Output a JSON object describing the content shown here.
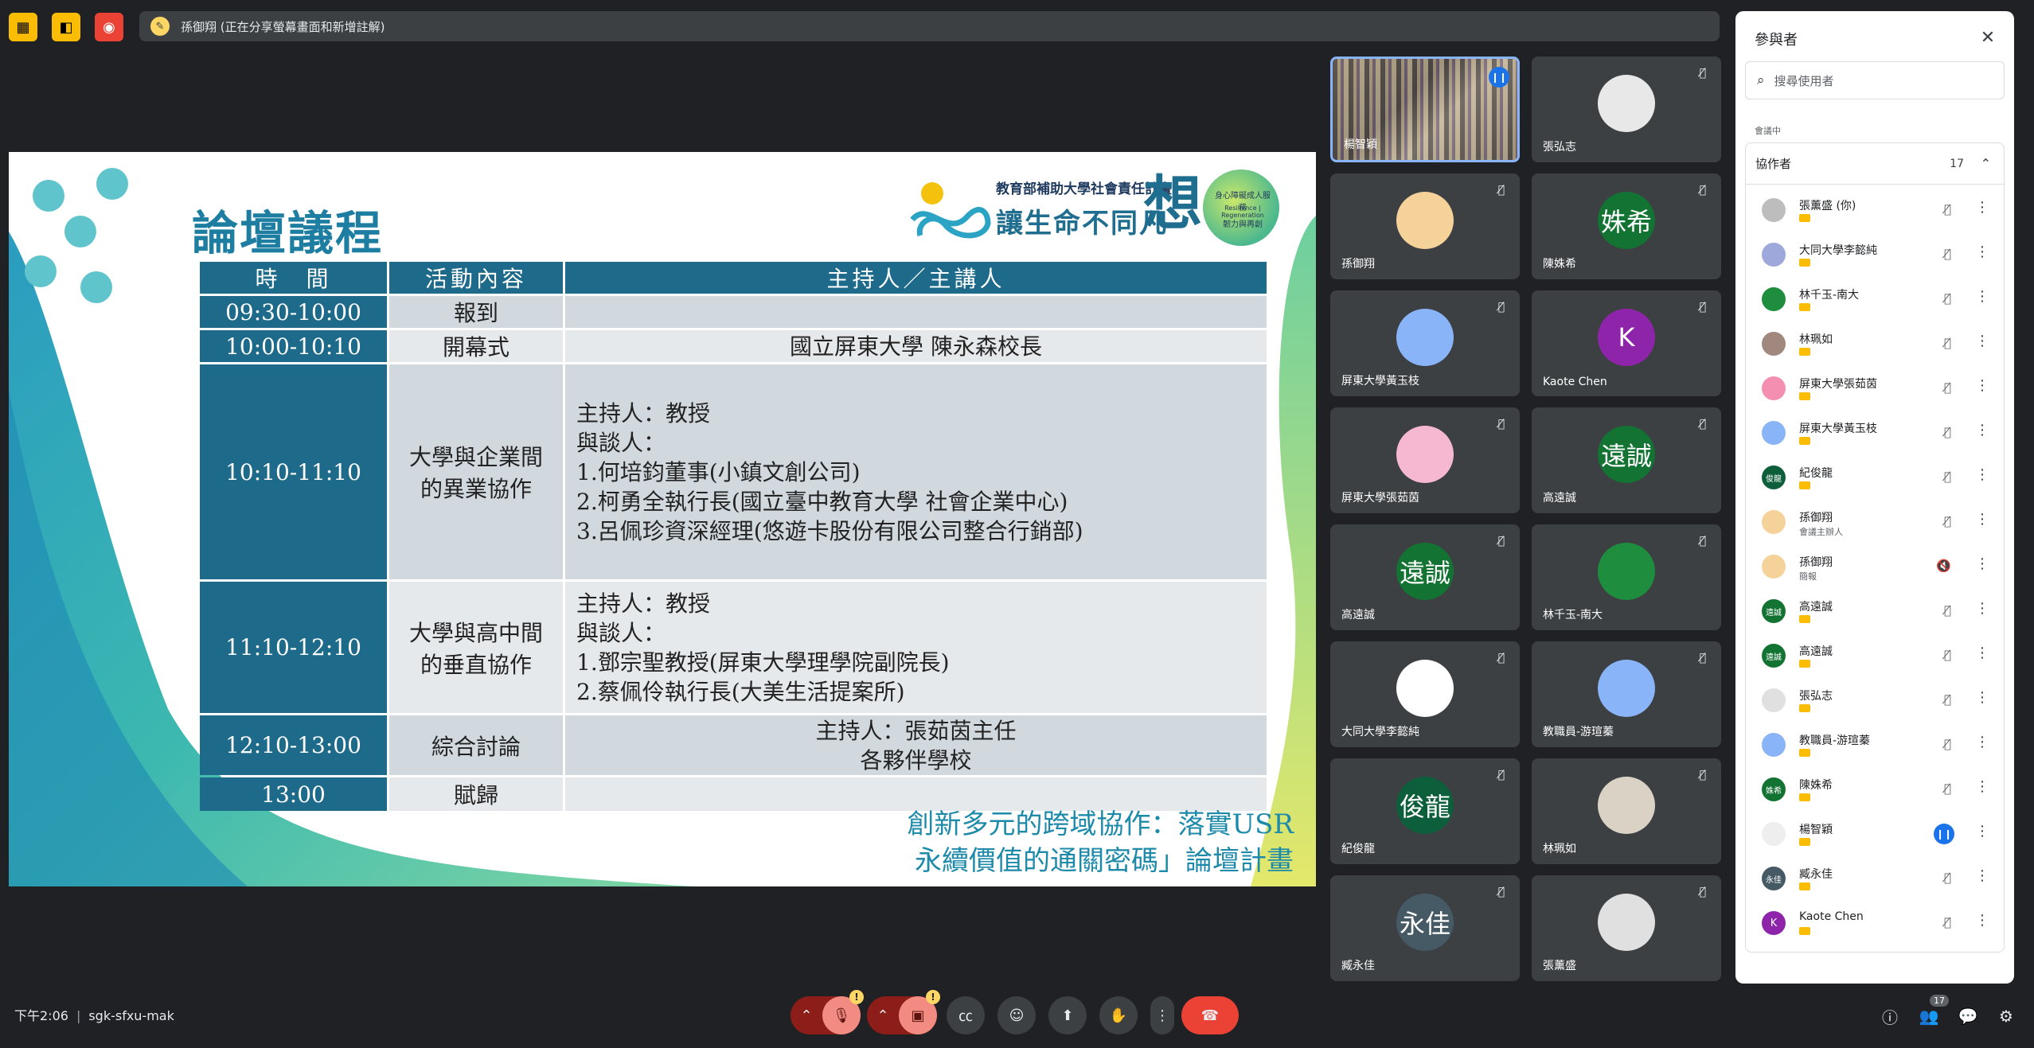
{
  "topbar": {
    "presenter_status": "孫御翔 (正在分享螢幕畫面和新增註解)"
  },
  "slide": {
    "title": "論壇議程",
    "logo": {
      "line1": "教育部補助大學社會責任計畫",
      "line2": "讓生命不同凡",
      "big": "想",
      "circle_line1": "身心障礙成人服務",
      "circle_line2": "Resilience | Regeneration",
      "circle_line3": "韌力與再創"
    },
    "table": {
      "headers": [
        "時　間",
        "活動內容",
        "主持人／主講人"
      ],
      "rows": [
        {
          "time": "09:30-10:00",
          "activity": "報到",
          "host": []
        },
        {
          "time": "10:00-10:10",
          "activity": "開幕式",
          "host": [
            "國立屏東大學 陳永森校長"
          ]
        },
        {
          "time": "10:10-11:10",
          "activity": "大學與企業間的異業協作",
          "host": [
            "主持人：教授",
            "與談人：",
            "1.何培鈞董事(小鎮文創公司)",
            "2.柯勇全執行長(國立臺中教育大學 社會企業中心)",
            "3.呂佩珍資深經理(悠遊卡股份有限公司整合行銷部)"
          ]
        },
        {
          "time": "11:10-12:10",
          "activity": "大學與高中間的垂直協作",
          "host": [
            "主持人：教授",
            "與談人：",
            "1.鄧宗聖教授(屏東大學理學院副院長)",
            "2.蔡佩伶執行長(大美生活提案所)"
          ]
        },
        {
          "time": "12:10-13:00",
          "activity": "綜合討論",
          "host": [
            "主持人：張茹茵主任",
            "各夥伴學校"
          ]
        },
        {
          "time": "13:00",
          "activity": "賦歸",
          "host": []
        }
      ]
    },
    "footer_line1": "創新多元的跨域協作：落實USR",
    "footer_line2": "永續價值的通關密碼」論壇計畫"
  },
  "tiles": [
    {
      "name": "楊智穎",
      "initial": "",
      "color": "#8a7a55"
    },
    {
      "name": "張弘志",
      "initial": "",
      "color": "#e8e8e8"
    },
    {
      "name": "孫御翔",
      "initial": "",
      "color": "#f5d29a"
    },
    {
      "name": "陳姝希",
      "initial": "姝希",
      "color": "#137333"
    },
    {
      "name": "屏東大學黃玉枝",
      "initial": "",
      "color": "#8ab4f8"
    },
    {
      "name": "Kaote Chen",
      "initial": "K",
      "color": "#8e24aa"
    },
    {
      "name": "屏東大學張茹茵",
      "initial": "",
      "color": "#f6b8d0"
    },
    {
      "name": "高遠誠",
      "initial": "遠誠",
      "color": "#137333"
    },
    {
      "name": "高遠誠",
      "initial": "遠誠",
      "color": "#137333"
    },
    {
      "name": "林千玉-南大",
      "initial": "",
      "color": "#1e8e3e"
    },
    {
      "name": "大同大學李懿純",
      "initial": "",
      "color": "#ffffff"
    },
    {
      "name": "教職員-游瑄蓁",
      "initial": "",
      "color": "#8ab4f8"
    },
    {
      "name": "紀俊龍",
      "initial": "俊龍",
      "color": "#0d5e3a"
    },
    {
      "name": "林珮如",
      "initial": "",
      "color": "#d9d2c5"
    },
    {
      "name": "臧永佳",
      "initial": "永佳",
      "color": "#455a64"
    },
    {
      "name": "張薰盛",
      "initial": "",
      "color": "#e0e0e0"
    }
  ],
  "panel": {
    "title": "參與者",
    "search_placeholder": "搜尋使用者",
    "section_label": "會議中",
    "group_name": "協作者",
    "group_count": "17",
    "people": [
      {
        "name": "張薰盛 (你)",
        "sub": "",
        "initial": "",
        "color": "#bdbdbd",
        "mic": "off"
      },
      {
        "name": "大同大學李懿純",
        "sub": "",
        "initial": "",
        "color": "#9fa8da",
        "mic": "off"
      },
      {
        "name": "林千玉-南大",
        "sub": "",
        "initial": "",
        "color": "#1e8e3e",
        "mic": "off"
      },
      {
        "name": "林珮如",
        "sub": "",
        "initial": "",
        "color": "#a1887f",
        "mic": "off"
      },
      {
        "name": "屏東大學張茹茵",
        "sub": "",
        "initial": "",
        "color": "#f48fb1",
        "mic": "off"
      },
      {
        "name": "屏東大學黃玉枝",
        "sub": "",
        "initial": "",
        "color": "#8ab4f8",
        "mic": "off"
      },
      {
        "name": "紀俊龍",
        "sub": "",
        "initial": "俊龍",
        "color": "#0d5e3a",
        "mic": "off"
      },
      {
        "name": "孫御翔",
        "sub": "會議主辦人",
        "initial": "",
        "color": "#f5d29a",
        "mic": "off"
      },
      {
        "name": "孫御翔",
        "sub": "簡報",
        "initial": "",
        "color": "#f5d29a",
        "mic": "muted"
      },
      {
        "name": "高遠誠",
        "sub": "",
        "initial": "遠誠",
        "color": "#137333",
        "mic": "off"
      },
      {
        "name": "高遠誠",
        "sub": "",
        "initial": "遠誠",
        "color": "#137333",
        "mic": "off"
      },
      {
        "name": "張弘志",
        "sub": "",
        "initial": "",
        "color": "#e0e0e0",
        "mic": "off"
      },
      {
        "name": "教職員-游瑄蓁",
        "sub": "",
        "initial": "",
        "color": "#8ab4f8",
        "mic": "off"
      },
      {
        "name": "陳姝希",
        "sub": "",
        "initial": "姝希",
        "color": "#137333",
        "mic": "off"
      },
      {
        "name": "楊智穎",
        "sub": "",
        "initial": "",
        "color": "#eeeeee",
        "mic": "on"
      },
      {
        "name": "臧永佳",
        "sub": "",
        "initial": "永佳",
        "color": "#455a64",
        "mic": "off"
      },
      {
        "name": "Kaote Chen",
        "sub": "",
        "initial": "K",
        "color": "#8e24aa",
        "mic": "off"
      }
    ]
  },
  "bottom": {
    "time": "下午2:06",
    "meeting_code": "sgk-sfxu-mak",
    "people_count": "17"
  }
}
